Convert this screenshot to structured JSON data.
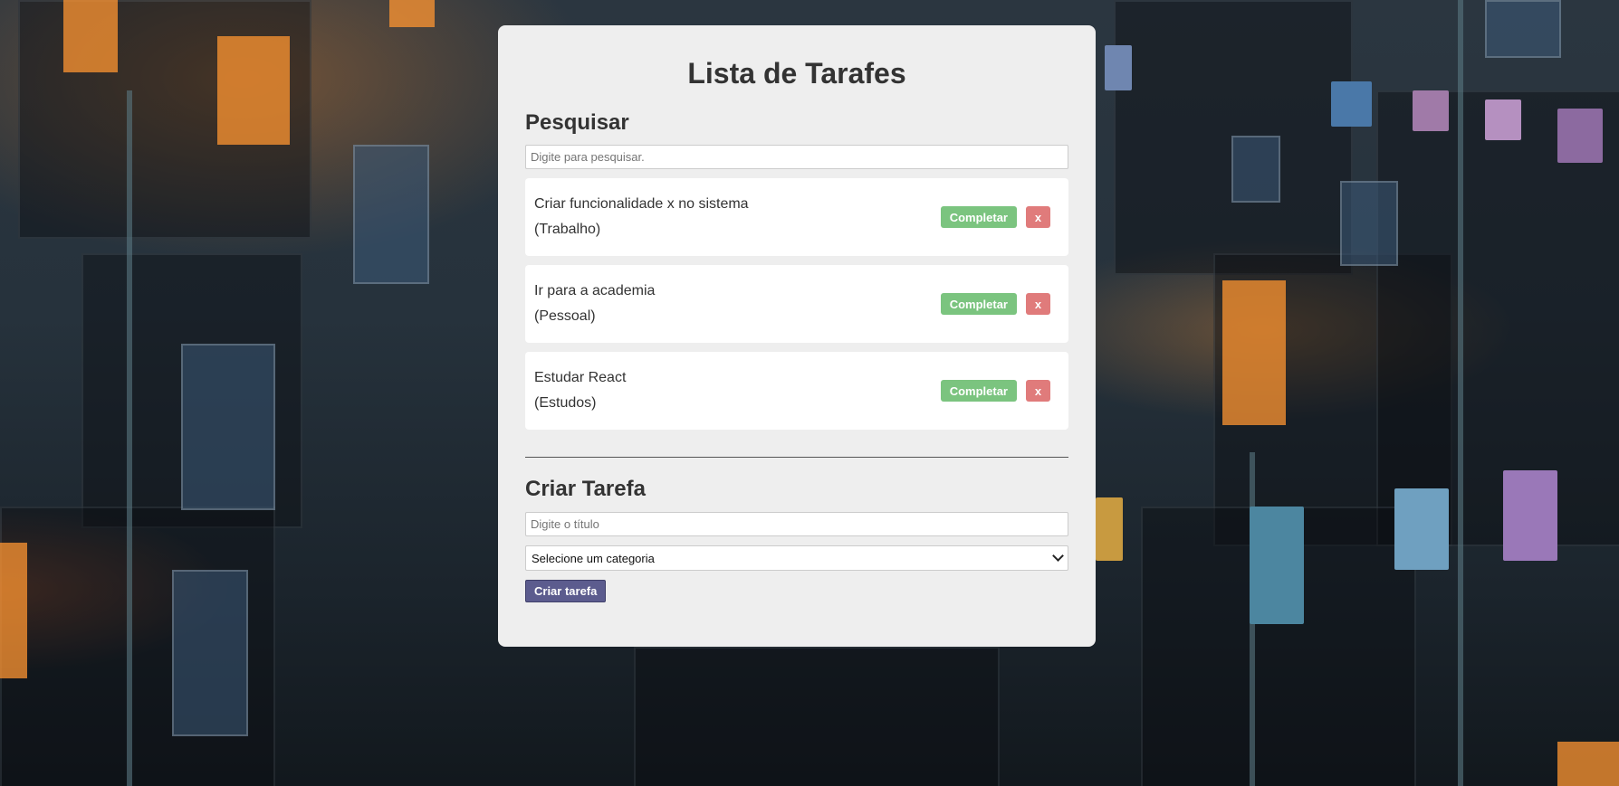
{
  "app": {
    "title": "Lista de Tarafes"
  },
  "search": {
    "heading": "Pesquisar",
    "placeholder": "Digite para pesquisar.",
    "value": ""
  },
  "todos": [
    {
      "text": "Criar funcionalidade x no sistema",
      "category": "(Trabalho)",
      "complete_label": "Completar",
      "remove_label": "x"
    },
    {
      "text": "Ir para a academia",
      "category": "(Pessoal)",
      "complete_label": "Completar",
      "remove_label": "x"
    },
    {
      "text": "Estudar React",
      "category": "(Estudos)",
      "complete_label": "Completar",
      "remove_label": "x"
    }
  ],
  "create": {
    "heading": "Criar Tarefa",
    "title_placeholder": "Digite o título",
    "title_value": "",
    "category_selected": "Selecione um categoria",
    "submit_label": "Criar tarefa"
  },
  "colors": {
    "card_bg": "#eeeeee",
    "complete_button": "#7bc47f",
    "remove_button": "#e07b7b",
    "create_button": "#5c5c8e",
    "text": "#333333"
  }
}
